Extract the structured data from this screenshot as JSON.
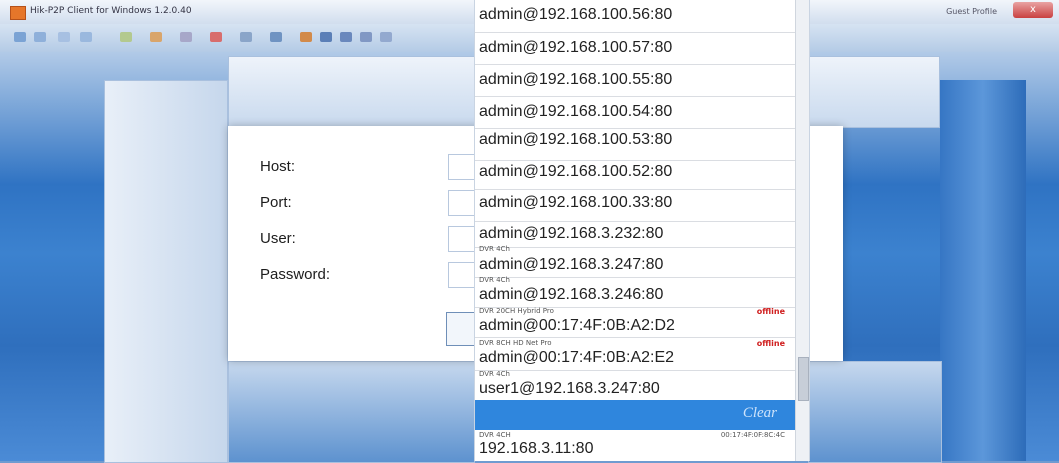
{
  "window": {
    "title": "Hik-P2P Client for Windows 1.2.0.40",
    "title_right": "Guest Profile",
    "close_label": "x"
  },
  "login": {
    "labels": {
      "host": "Host:",
      "port": "Port:",
      "user": "User:",
      "password": "Password:"
    }
  },
  "dropdown": {
    "items": [
      {
        "address": "admin@192.168.100.56:80",
        "subtitle": "",
        "status": "",
        "mac": ""
      },
      {
        "address": "admin@192.168.100.57:80",
        "subtitle": "",
        "status": "",
        "mac": ""
      },
      {
        "address": "admin@192.168.100.55:80",
        "subtitle": "",
        "status": "",
        "mac": ""
      },
      {
        "address": "admin@192.168.100.54:80",
        "subtitle": "",
        "status": "",
        "mac": ""
      },
      {
        "address": "admin@192.168.100.53:80",
        "subtitle": "",
        "status": "",
        "mac": ""
      },
      {
        "address": "admin@192.168.100.52:80",
        "subtitle": "",
        "status": "",
        "mac": ""
      },
      {
        "address": "admin@192.168.100.33:80",
        "subtitle": "",
        "status": "",
        "mac": ""
      },
      {
        "address": "admin@192.168.3.232:80",
        "subtitle": "",
        "status": "",
        "mac": ""
      },
      {
        "address": "admin@192.168.3.247:80",
        "subtitle": "DVR 4Ch",
        "status": "",
        "mac": ""
      },
      {
        "address": "admin@192.168.3.246:80",
        "subtitle": "DVR 4Ch",
        "status": "",
        "mac": ""
      },
      {
        "address": "admin@00:17:4F:0B:A2:D2",
        "subtitle": "DVR 20CH Hybrid Pro",
        "status": "offline",
        "mac": ""
      },
      {
        "address": "admin@00:17:4F:0B:A2:E2",
        "subtitle": "DVR 8CH HD Net Pro",
        "status": "offline",
        "mac": ""
      },
      {
        "address": "user1@192.168.3.247:80",
        "subtitle": "DVR 4Ch",
        "status": "",
        "mac": ""
      }
    ],
    "clear_label": "Clear",
    "last_item": {
      "address": "192.168.3.11:80",
      "subtitle": "DVR 4CH",
      "mac": "00:17:4F:0F:8C:4C"
    }
  },
  "colors": {
    "accent": "#2f86dd",
    "offline": "#d02020"
  }
}
